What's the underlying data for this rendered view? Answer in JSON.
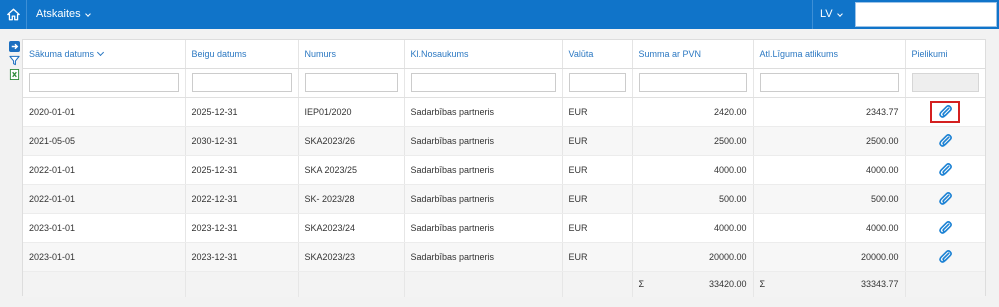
{
  "header": {
    "menu_title": "Atskaites",
    "language": "LV",
    "search_value": ""
  },
  "colors": {
    "topbar": "#1074c9",
    "header_text": "#2b78c2",
    "attachment_icon": "#1c82d4",
    "selection_border": "#d42020"
  },
  "icons": {
    "home": "home-icon",
    "export": "arrow-right-icon",
    "filter": "filter-icon",
    "excel": "excel-icon",
    "attachment": "paperclip-icon"
  },
  "table": {
    "columns": [
      "Sākuma datums",
      "Beigu datums",
      "Numurs",
      "Kl.Nosaukums",
      "Valūta",
      "Summa ar PVN",
      "Atl.Līguma atlikums",
      "Pielikumi"
    ],
    "rows": [
      {
        "start": "2020-01-01",
        "end": "2025-12-31",
        "number": "IEP01/2020",
        "client": "Sadarbības partneris",
        "currency": "EUR",
        "sum": "2420.00",
        "balance": "2343.77"
      },
      {
        "start": "2021-05-05",
        "end": "2030-12-31",
        "number": "SKA2023/26",
        "client": "Sadarbības partneris",
        "currency": "EUR",
        "sum": "2500.00",
        "balance": "2500.00"
      },
      {
        "start": "2022-01-01",
        "end": "2025-12-31",
        "number": "SKA 2023/25",
        "client": "Sadarbības partneris",
        "currency": "EUR",
        "sum": "4000.00",
        "balance": "4000.00"
      },
      {
        "start": "2022-01-01",
        "end": "2022-12-31",
        "number": "SK- 2023/28",
        "client": "Sadarbības partneris",
        "currency": "EUR",
        "sum": "500.00",
        "balance": "500.00"
      },
      {
        "start": "2023-01-01",
        "end": "2023-12-31",
        "number": "SKA2023/24",
        "client": "Sadarbības partneris",
        "currency": "EUR",
        "sum": "4000.00",
        "balance": "4000.00"
      },
      {
        "start": "2023-01-01",
        "end": "2023-12-31",
        "number": "SKA2023/23",
        "client": "Sadarbības partneris",
        "currency": "EUR",
        "sum": "20000.00",
        "balance": "20000.00"
      }
    ],
    "totals": {
      "sigma": "Σ",
      "sum": "33420.00",
      "balance": "33343.77"
    }
  }
}
